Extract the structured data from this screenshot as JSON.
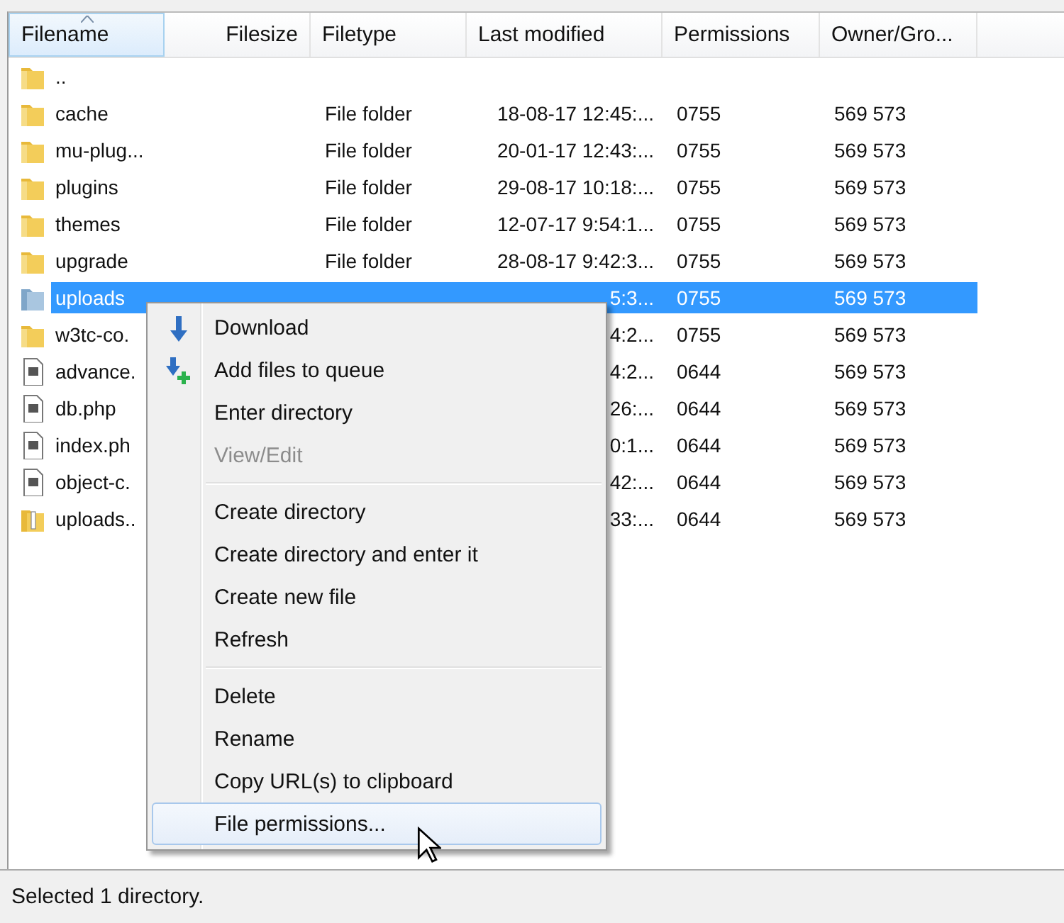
{
  "columns": [
    {
      "label": "Filename",
      "sorted": true
    },
    {
      "label": "Filesize",
      "sorted": false
    },
    {
      "label": "Filetype",
      "sorted": false
    },
    {
      "label": "Last modified",
      "sorted": false
    },
    {
      "label": "Permissions",
      "sorted": false
    },
    {
      "label": "Owner/Gro...",
      "sorted": false
    }
  ],
  "rows": [
    {
      "kind": "folder",
      "name": "..",
      "selected": false
    },
    {
      "kind": "folder",
      "name": "cache",
      "filetype": "File folder",
      "modified": "18-08-17 12:45:...",
      "permissions": "0755",
      "owner": "569 573",
      "selected": false
    },
    {
      "kind": "folder",
      "name": "mu-plug...",
      "filetype": "File folder",
      "modified": "20-01-17 12:43:...",
      "permissions": "0755",
      "owner": "569 573",
      "selected": false
    },
    {
      "kind": "folder",
      "name": "plugins",
      "filetype": "File folder",
      "modified": "29-08-17 10:18:...",
      "permissions": "0755",
      "owner": "569 573",
      "selected": false
    },
    {
      "kind": "folder",
      "name": "themes",
      "filetype": "File folder",
      "modified": "12-07-17 9:54:1...",
      "permissions": "0755",
      "owner": "569 573",
      "selected": false
    },
    {
      "kind": "folder",
      "name": "upgrade",
      "filetype": "File folder",
      "modified": "28-08-17 9:42:3...",
      "permissions": "0755",
      "owner": "569 573",
      "selected": false
    },
    {
      "kind": "folder",
      "name": "uploads",
      "modified": "5:3...",
      "permissions": "0755",
      "owner": "569 573",
      "selected": true
    },
    {
      "kind": "folder",
      "name": "w3tc-co.",
      "modified": "4:2...",
      "permissions": "0755",
      "owner": "569 573",
      "selected": false
    },
    {
      "kind": "file",
      "name": "advance.",
      "modified": "4:2...",
      "permissions": "0644",
      "owner": "569 573",
      "selected": false
    },
    {
      "kind": "file",
      "name": "db.php",
      "modified": "26:...",
      "permissions": "0644",
      "owner": "569 573",
      "selected": false
    },
    {
      "kind": "file",
      "name": "index.ph",
      "modified": "0:1...",
      "permissions": "0644",
      "owner": "569 573",
      "selected": false
    },
    {
      "kind": "file",
      "name": "object-c.",
      "modified": "42:...",
      "permissions": "0644",
      "owner": "569 573",
      "selected": false
    },
    {
      "kind": "archive",
      "name": "uploads..",
      "modified": "33:...",
      "permissions": "0644",
      "owner": "569 573",
      "selected": false
    }
  ],
  "context_menu": [
    {
      "kind": "download",
      "label": "Download",
      "disabled": false,
      "selected": false
    },
    {
      "kind": "queue",
      "label": "Add files to queue",
      "disabled": false,
      "selected": false
    },
    {
      "kind": "item",
      "label": "Enter directory",
      "disabled": false,
      "selected": false
    },
    {
      "kind": "item",
      "label": "View/Edit",
      "disabled": true,
      "selected": false
    },
    {
      "kind": "separator"
    },
    {
      "kind": "item",
      "label": "Create directory",
      "disabled": false,
      "selected": false
    },
    {
      "kind": "item",
      "label": "Create directory and enter it",
      "disabled": false,
      "selected": false
    },
    {
      "kind": "item",
      "label": "Create new file",
      "disabled": false,
      "selected": false
    },
    {
      "kind": "item",
      "label": "Refresh",
      "disabled": false,
      "selected": false
    },
    {
      "kind": "separator"
    },
    {
      "kind": "item",
      "label": "Delete",
      "disabled": false,
      "selected": false
    },
    {
      "kind": "item",
      "label": "Rename",
      "disabled": false,
      "selected": false
    },
    {
      "kind": "item",
      "label": "Copy URL(s) to clipboard",
      "disabled": false,
      "selected": false
    },
    {
      "kind": "item",
      "label": "File permissions...",
      "disabled": false,
      "selected": true
    }
  ],
  "status_bar": "Selected 1 directory."
}
